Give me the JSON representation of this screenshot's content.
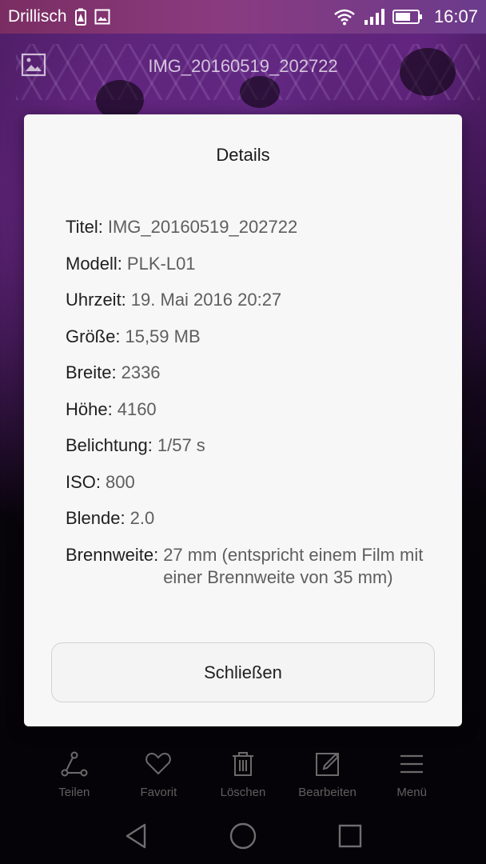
{
  "status_bar": {
    "carrier": "Drillisch",
    "time": "16:07",
    "icons": [
      "battery-alert-icon",
      "image-notification-icon",
      "wifi-icon",
      "signal-icon",
      "battery-icon"
    ]
  },
  "gallery": {
    "title": "IMG_20160519_202722",
    "thumbnail_icon": "image-icon"
  },
  "dialog": {
    "title": "Details",
    "rows": [
      {
        "label": "Titel:",
        "value": "IMG_20160519_202722"
      },
      {
        "label": "Modell:",
        "value": "PLK-L01"
      },
      {
        "label": "Uhrzeit:",
        "value": "19. Mai 2016 20:27"
      },
      {
        "label": "Größe:",
        "value": "15,59 MB"
      },
      {
        "label": "Breite:",
        "value": "2336"
      },
      {
        "label": "Höhe:",
        "value": "4160"
      },
      {
        "label": "Belichtung:",
        "value": "1/57 s"
      },
      {
        "label": "ISO:",
        "value": "800"
      },
      {
        "label": "Blende:",
        "value": "2.0"
      },
      {
        "label": "Brennweite:",
        "value": "27 mm (entspricht einem Film mit einer Brennweite von 35 mm)"
      }
    ],
    "close_label": "Schließen"
  },
  "action_bar": {
    "items": [
      {
        "label": "Teilen",
        "icon": "share-icon"
      },
      {
        "label": "Favorit",
        "icon": "heart-icon"
      },
      {
        "label": "Löschen",
        "icon": "trash-icon"
      },
      {
        "label": "Bearbeiten",
        "icon": "edit-icon"
      },
      {
        "label": "Menü",
        "icon": "menu-icon"
      }
    ]
  },
  "nav_bar": {
    "icons": [
      "back-icon",
      "home-icon",
      "recents-icon"
    ]
  },
  "colors": {
    "status_bar": "#8a3b80",
    "dialog_bg": "#f7f7f7",
    "label_text": "#1f1f1f",
    "value_text": "#5e5e5e"
  }
}
